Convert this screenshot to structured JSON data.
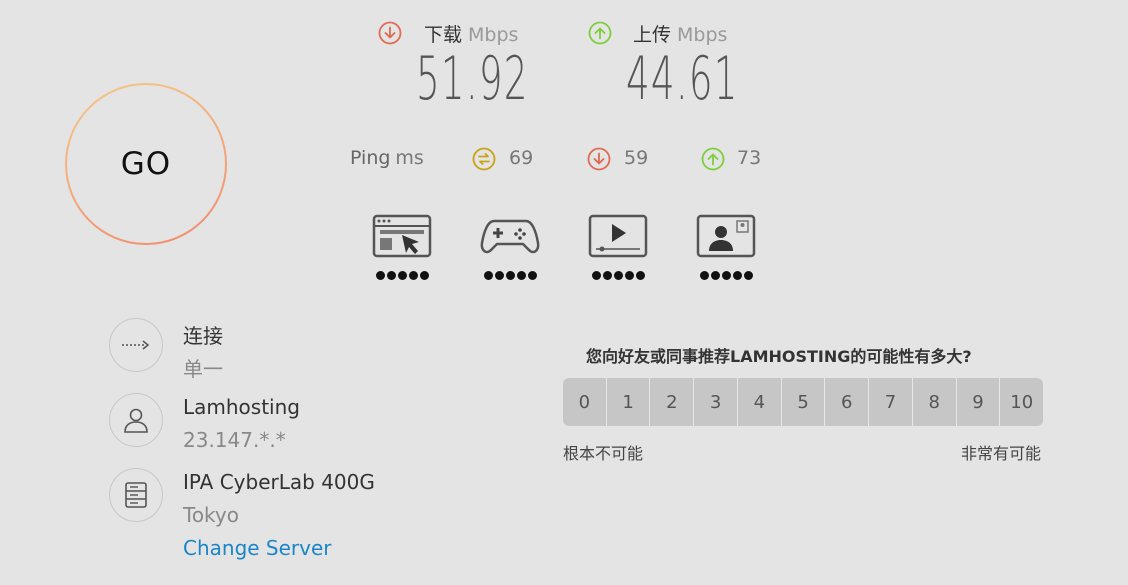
{
  "go_label": "GO",
  "download": {
    "label": "下载",
    "unit": "Mbps",
    "value": "51.92",
    "color": "#e06a52"
  },
  "upload": {
    "label": "上传",
    "unit": "Mbps",
    "value": "44.61",
    "color": "#7ccf3a"
  },
  "ping": {
    "label": "Ping",
    "unit": "ms",
    "idle": "69",
    "download": "59",
    "upload": "73",
    "idle_color": "#c9a215"
  },
  "activities": [
    {
      "icon": "web-browsing-icon",
      "rating": 5
    },
    {
      "icon": "gaming-icon",
      "rating": 5
    },
    {
      "icon": "video-streaming-icon",
      "rating": 5
    },
    {
      "icon": "video-call-icon",
      "rating": 5
    }
  ],
  "connection": {
    "title": "连接",
    "sub": "单一"
  },
  "isp": {
    "title": "Lamhosting",
    "sub": "23.147.*.*"
  },
  "server": {
    "title": "IPA CyberLab 400G",
    "sub": "Tokyo",
    "change_label": "Change Server"
  },
  "nps": {
    "question": "您向好友或同事推荐LAMHOSTING的可能性有多大?",
    "scale": [
      "0",
      "1",
      "2",
      "3",
      "4",
      "5",
      "6",
      "7",
      "8",
      "9",
      "10"
    ],
    "low_label": "根本不可能",
    "high_label": "非常有可能"
  }
}
